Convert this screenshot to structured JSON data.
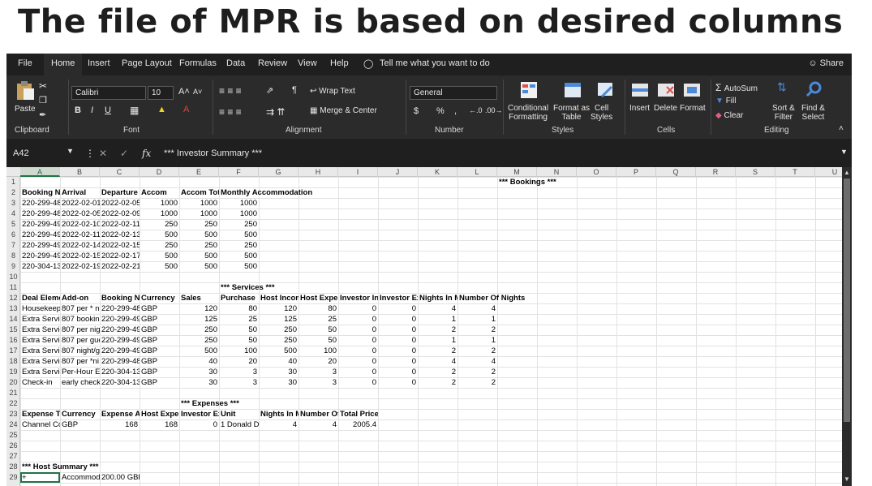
{
  "slide_title": "The file of MPR is based on desired columns",
  "menu": {
    "tabs": [
      "File",
      "Home",
      "Insert",
      "Page Layout",
      "Formulas",
      "Data",
      "Review",
      "View",
      "Help"
    ],
    "tell_me": "Tell me what you want to do",
    "share": "Share"
  },
  "ribbon": {
    "clipboard": {
      "paste": "Paste",
      "label": "Clipboard"
    },
    "font": {
      "name": "Calibri",
      "size": "10",
      "bold": "B",
      "italic": "I",
      "underline": "U",
      "label": "Font"
    },
    "alignment": {
      "wrap_text": "Wrap Text",
      "merge_center": "Merge & Center",
      "label": "Alignment"
    },
    "number": {
      "format": "General",
      "currency": "$",
      "percent": "%",
      "comma": ",",
      "label": "Number"
    },
    "styles": {
      "conditional": "Conditional",
      "formatting": "Formatting",
      "format_as": "Format as",
      "table": "Table",
      "cell": "Cell",
      "cell_styles": "Styles",
      "label": "Styles"
    },
    "cells": {
      "insert": "Insert",
      "delete": "Delete",
      "format": "Format",
      "label": "Cells"
    },
    "editing": {
      "autosum": "AutoSum",
      "fill": "Fill",
      "clear": "Clear",
      "sort": "Sort &",
      "filter": "Filter",
      "find": "Find &",
      "select": "Select",
      "label": "Editing"
    }
  },
  "formula_bar": {
    "cell_ref": "A42",
    "fx": "fx",
    "content": "*** Investor Summary ***"
  },
  "columns": [
    "A",
    "B",
    "C",
    "D",
    "E",
    "F",
    "G",
    "H",
    "I",
    "J",
    "K",
    "L",
    "M",
    "N",
    "O",
    "P",
    "Q",
    "R",
    "S",
    "T",
    "U"
  ],
  "rows": [
    "1",
    "2",
    "3",
    "4",
    "5",
    "6",
    "7",
    "8",
    "9",
    "10",
    "11",
    "12",
    "13",
    "14",
    "15",
    "16",
    "17",
    "18",
    "19",
    "20",
    "21",
    "22",
    "23",
    "24",
    "25",
    "26",
    "27",
    "28",
    "29"
  ],
  "sheet": {
    "bookings_title": "*** Bookings ***",
    "bookings_headers": [
      "Booking No",
      "Arrival",
      "Departure",
      "Accom",
      "Accom Tota",
      "Monthly Accommodation"
    ],
    "bookings_rows": [
      [
        "220-299-48",
        "2022-02-01",
        "2022-02-05",
        "1000",
        "1000",
        "1000"
      ],
      [
        "220-299-48",
        "2022-02-05",
        "2022-02-09",
        "1000",
        "1000",
        "1000"
      ],
      [
        "220-299-49",
        "2022-02-10",
        "2022-02-11",
        "250",
        "250",
        "250"
      ],
      [
        "220-299-49",
        "2022-02-11",
        "2022-02-13",
        "500",
        "500",
        "500"
      ],
      [
        "220-299-49",
        "2022-02-14",
        "2022-02-15",
        "250",
        "250",
        "250"
      ],
      [
        "220-299-49",
        "2022-02-15",
        "2022-02-17",
        "500",
        "500",
        "500"
      ],
      [
        "220-304-13",
        "2022-02-19",
        "2022-02-21",
        "500",
        "500",
        "500"
      ]
    ],
    "services_title": "*** Services ***",
    "services_headers": [
      "Deal Eleme",
      "Add-on",
      "Booking No",
      "Currency",
      "Sales",
      "Purchase",
      "Host Incom",
      "Host Expen",
      "Investor Inc",
      "Investor Ex",
      "Nights In M",
      "Number Of Nights"
    ],
    "services_rows": [
      [
        "Housekeepi",
        "807 per * ni",
        "220-299-48",
        "GBP",
        "120",
        "80",
        "120",
        "80",
        "0",
        "0",
        "4",
        "4"
      ],
      [
        "Extra Servic",
        "807 bookin",
        "220-299-49",
        "GBP",
        "125",
        "25",
        "125",
        "25",
        "0",
        "0",
        "1",
        "1"
      ],
      [
        "Extra Servic",
        "807 per nig",
        "220-299-49",
        "GBP",
        "250",
        "50",
        "250",
        "50",
        "0",
        "0",
        "2",
        "2"
      ],
      [
        "Extra Servic",
        "807 per gue",
        "220-299-49",
        "GBP",
        "250",
        "50",
        "250",
        "50",
        "0",
        "0",
        "1",
        "1"
      ],
      [
        "Extra Servic",
        "807 night/g",
        "220-299-49",
        "GBP",
        "500",
        "100",
        "500",
        "100",
        "0",
        "0",
        "2",
        "2"
      ],
      [
        "Extra Servic",
        "807 per *ni",
        "220-299-48",
        "GBP",
        "40",
        "20",
        "40",
        "20",
        "0",
        "0",
        "4",
        "4"
      ],
      [
        "Extra Servic",
        "Per-Hour Ea",
        "220-304-13",
        "GBP",
        "30",
        "3",
        "30",
        "3",
        "0",
        "0",
        "2",
        "2"
      ],
      [
        "Check-in",
        "early check",
        "220-304-13",
        "GBP",
        "30",
        "3",
        "30",
        "3",
        "0",
        "0",
        "2",
        "2"
      ]
    ],
    "expenses_title": "*** Expenses ***",
    "expenses_headers": [
      "Expense Ty",
      "Currency",
      "Expense Ar",
      "Host Expen",
      "Investor Ex",
      "Unit",
      "Nights In M",
      "Number Of",
      "Total Price"
    ],
    "expenses_row": [
      "Channel Co",
      "GBP",
      "168",
      "168",
      "0",
      "1 Donald D",
      "4",
      "4",
      "2005.4"
    ],
    "host_title": "*** Host Summary ***",
    "host_row": [
      "+",
      "Accommod",
      "200.00 GBP"
    ]
  },
  "colors": {
    "excel_green": "#217346",
    "dark_bg": "#1f1f1f",
    "ribbon_bg": "#2b2b2b"
  }
}
